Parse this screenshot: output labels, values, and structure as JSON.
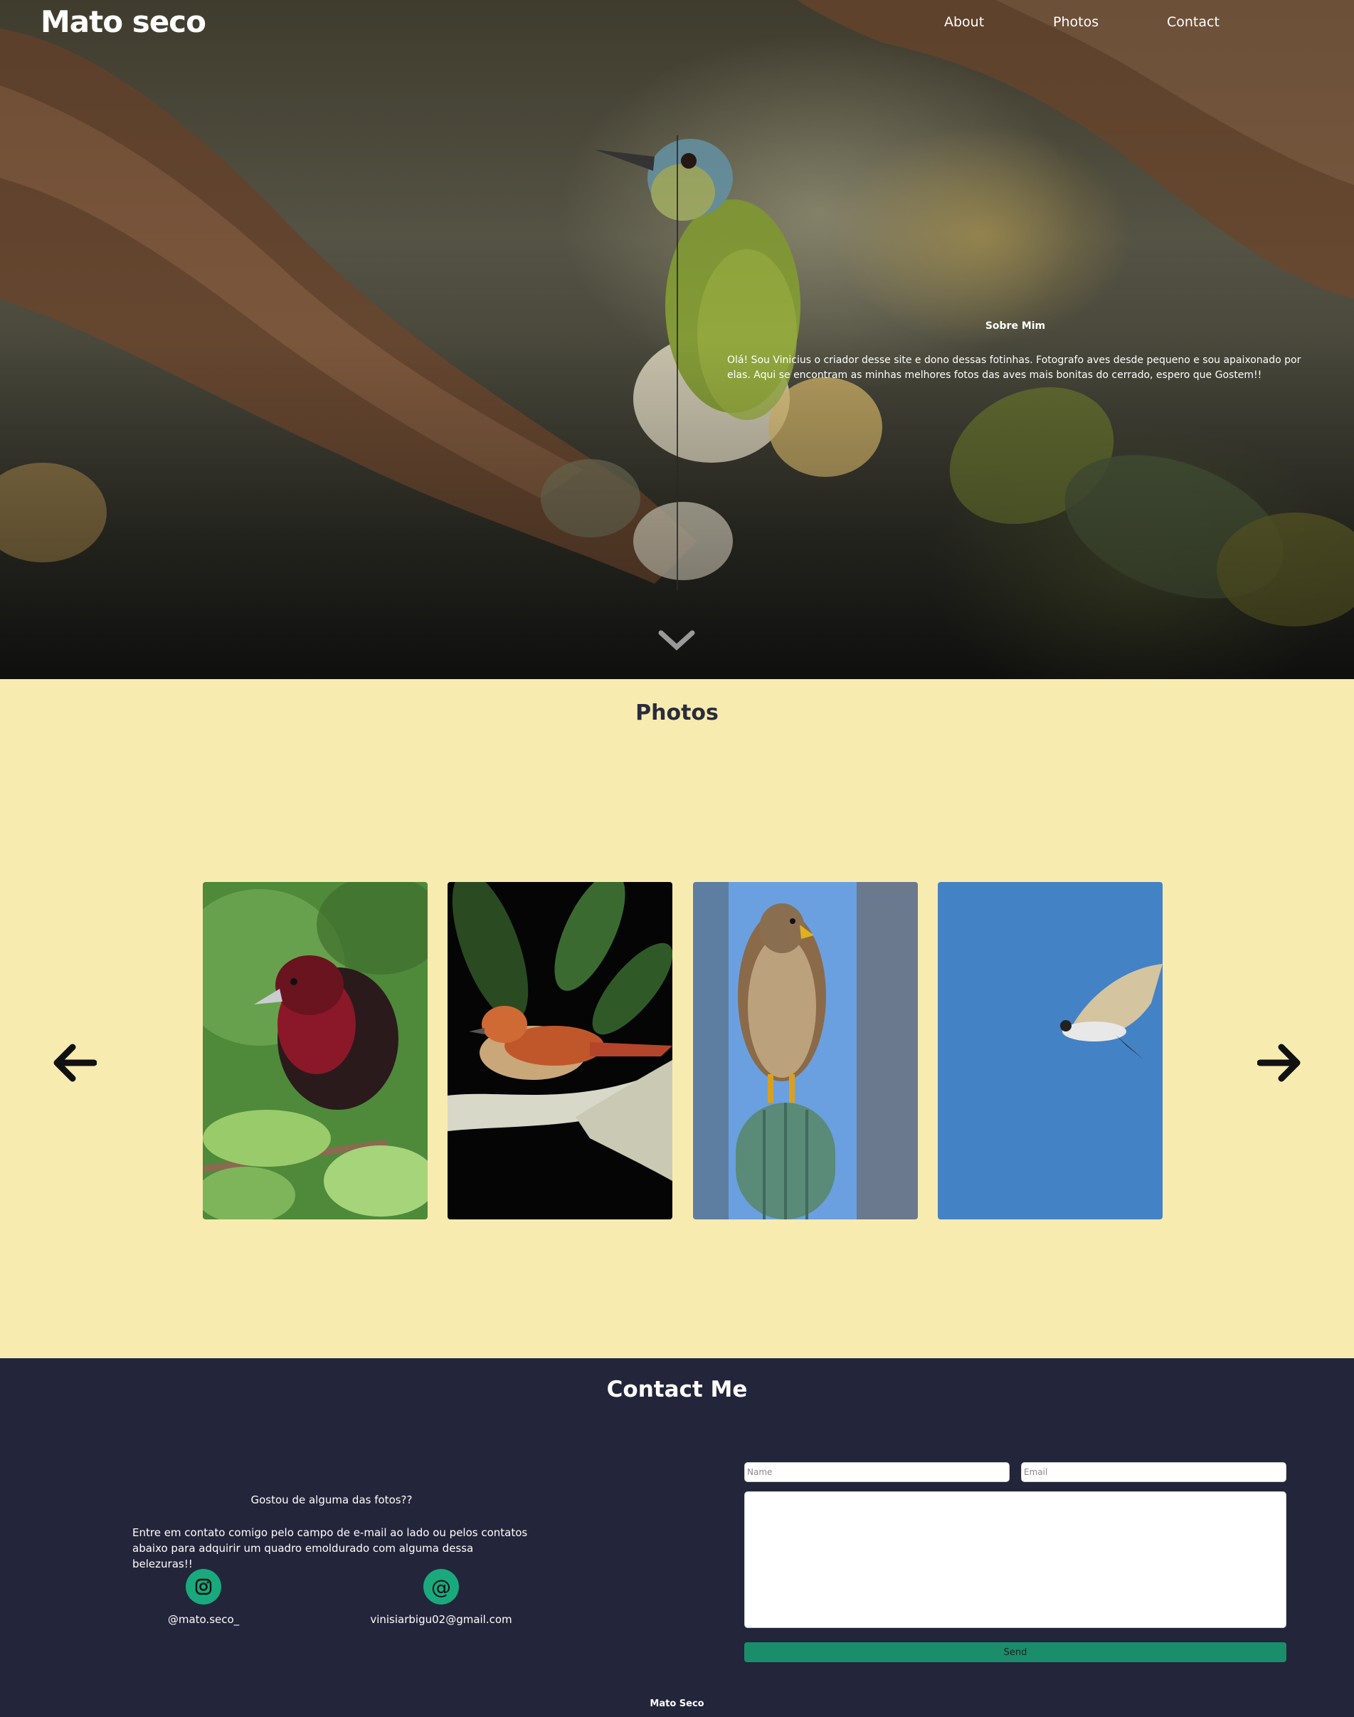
{
  "header": {
    "logo": "Mato seco",
    "nav": [
      {
        "label": "About"
      },
      {
        "label": "Photos"
      },
      {
        "label": "Contact"
      }
    ]
  },
  "about": {
    "title": "Sobre Mim",
    "text": "Olá! Sou Vinicius o criador desse site e dono dessas fotinhas. Fotografo aves desde pequeno e sou apaixonado por elas. Aqui se encontram as minhas melhores fotos das aves mais bonitas do cerrado, espero que Gostem!!",
    "scroll_icon": "chevron-down-icon"
  },
  "photos": {
    "title": "Photos",
    "prev_icon": "arrow-left-icon",
    "next_icon": "arrow-right-icon",
    "items": [
      {
        "subject": "red-and-black tanager on branch",
        "bg": "#4e8a3a"
      },
      {
        "subject": "rufous-crowned bird on white branch",
        "bg": "#050505"
      },
      {
        "subject": "hawk perched on cactus",
        "bg": "#6aa0e0"
      },
      {
        "subject": "kite in flight against blue sky",
        "bg": "#4482c6"
      }
    ]
  },
  "contact": {
    "title": "Contact Me",
    "question": "Gostou de alguma das fotos??",
    "body": "Entre em contato comigo pelo campo de e-mail ao lado ou pelos contatos abaixo para adquirir um quadro emoldurado com alguma dessa belezuras!!",
    "instagram": {
      "icon": "instagram-icon",
      "handle": "@mato.seco_"
    },
    "email": {
      "icon": "at-sign-icon",
      "address": "vinisiarbigu02@gmail.com"
    },
    "form": {
      "name_placeholder": "Name",
      "email_placeholder": "Email",
      "message_placeholder": "",
      "send_label": "Send"
    }
  },
  "footer": {
    "brand": "Mato Seco"
  },
  "colors": {
    "photos_bg": "#f8ebb0",
    "contact_bg": "#23253a",
    "accent": "#19a97c",
    "send_button": "#1a8d6b"
  }
}
